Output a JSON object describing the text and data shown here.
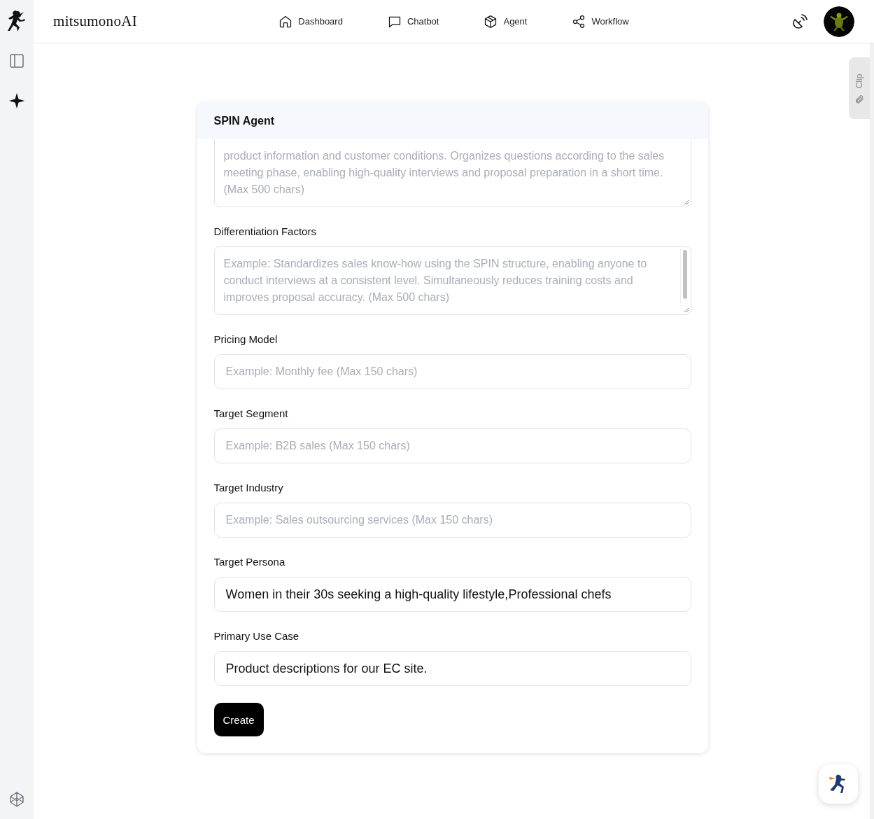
{
  "brand": "mitsumonoAI",
  "nav": [
    {
      "label": "Dashboard"
    },
    {
      "label": "Chatbot"
    },
    {
      "label": "Agent"
    },
    {
      "label": "Workflow"
    }
  ],
  "card": {
    "title": "SPIN Agent",
    "fields": [
      {
        "kind": "textarea",
        "scrolled": true,
        "placeholder": "product information and customer conditions. Organizes questions according to the sales meeting phase, enabling high-quality interviews and proposal preparation in a short time. (Max 500 chars)"
      },
      {
        "kind": "textarea",
        "label": "Differentiation Factors",
        "scrolled": false,
        "placeholder": "Example: Standardizes sales know-how using the SPIN structure, enabling anyone to conduct interviews at a consistent level. Simultaneously reduces training costs and improves proposal accuracy. (Max 500 chars)"
      },
      {
        "kind": "input",
        "label": "Pricing Model",
        "placeholder": "Example: Monthly fee (Max 150 chars)"
      },
      {
        "kind": "input",
        "label": "Target Segment",
        "placeholder": "Example: B2B sales (Max 150 chars)"
      },
      {
        "kind": "input",
        "label": "Target Industry",
        "placeholder": "Example: Sales outsourcing services (Max 150 chars)"
      },
      {
        "kind": "input",
        "label": "Target Persona",
        "value": "Women in their 30s seeking a high-quality lifestyle,Professional chefs"
      },
      {
        "kind": "input",
        "label": "Primary Use Case",
        "value": "Product descriptions for our EC site."
      }
    ],
    "submit": "Create"
  },
  "clip_tab": "Clip"
}
